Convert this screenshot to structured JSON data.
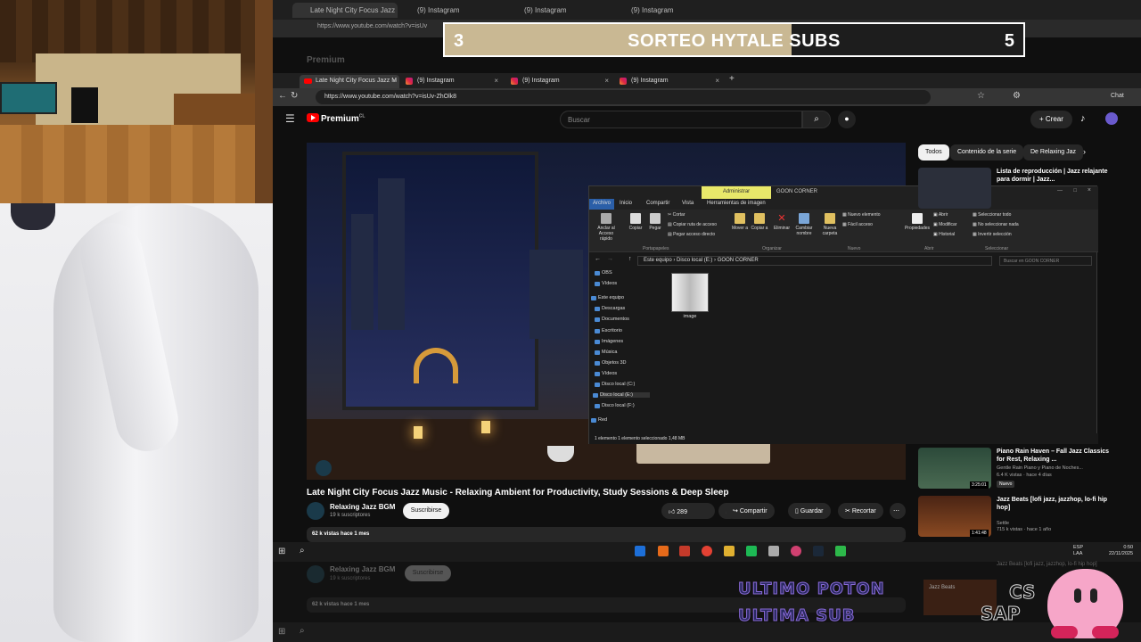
{
  "outer_tabs": [
    {
      "label": "Late Night City Focus Jazz M"
    },
    {
      "label": "(9) Instagram"
    },
    {
      "label": "(9) Instagram"
    },
    {
      "label": "(9) Instagram"
    }
  ],
  "outer_url": "https://www.youtube.com/watch?v=isUv",
  "sorteo": {
    "left_number": "3",
    "title": "SORTEO HYTALE SUBS",
    "right_number": "5",
    "progress_fraction": 0.6,
    "fill_color": "#c9b893"
  },
  "ghost_header": {
    "logo": "Premium"
  },
  "browser": {
    "tabs": [
      {
        "label": "Late Night City Focus Jazz M",
        "icon": "youtube-icon"
      },
      {
        "label": "(9) Instagram",
        "icon": "instagram-icon"
      },
      {
        "label": "(9) Instagram",
        "icon": "instagram-icon"
      },
      {
        "label": "(9) Instagram",
        "icon": "instagram-icon"
      }
    ],
    "new_tab": "+",
    "url": "https://www.youtube.com/watch?v=isUv-ZhOlk8",
    "chat_label": "Chat"
  },
  "youtube": {
    "logo": "Premium",
    "logo_sup": "CL",
    "search_placeholder": "Buscar",
    "create_label": "Crear",
    "chips": [
      "Todos",
      "Contenido de la serie",
      "De Relaxing Jaz"
    ],
    "video_title": "Late Night City Focus Jazz Music - Relaxing Ambient for Productivity, Study Sessions & Deep Sleep",
    "channel": "Relaxing Jazz BGM",
    "subscribers": "19 k suscriptores",
    "subscribe_label": "Suscribirse",
    "likes": "289",
    "share_label": "Compartir",
    "save_label": "Guardar",
    "clip_label": "Recortar",
    "views": "62 k vistas  hace 1 mes",
    "recommendations": [
      {
        "title": "Lista de reproducción | Jazz relajante para dormir | Jazz...",
        "meta1": "",
        "meta2": "",
        "duration": ""
      },
      {
        "title": "Piano Rain Haven – Fall Jazz Classics for Rest, Relaxing ...",
        "meta1": "Gentle Rain Piano y Piano de Noches...",
        "meta2": "6.4 K vistas · hace 4 días",
        "badge": "Nuevo",
        "duration": "3:25:01"
      },
      {
        "title": "Jazz Beats [lofi jazz, jazzhop, lo-fi hip hop]",
        "meta1": "Settle",
        "meta2": "715 k vistas · hace 1 año",
        "duration": "1:41:48"
      }
    ]
  },
  "explorer": {
    "admin_label": "Administrar",
    "window_title": "GOON CORNER",
    "menu": [
      "Archivo",
      "Inicio",
      "Compartir",
      "Vista",
      "Herramientas de imagen"
    ],
    "ribbon": {
      "pin": "Anclar al Acceso rápido",
      "copy": "Copiar",
      "paste": "Pegar",
      "cut": "Cortar",
      "copy_path": "Copiar ruta de acceso",
      "paste_shortcut": "Pegar acceso directo",
      "move": "Mover a",
      "copy_to": "Copiar a",
      "delete": "Eliminar",
      "rename": "Cambiar nombre",
      "new_folder": "Nueva carpeta",
      "new_item": "Nuevo elemento",
      "easy_access": "Fácil acceso",
      "properties": "Propiedades",
      "open": "Abrir",
      "modify": "Modificar",
      "history": "Historial",
      "select_all": "Seleccionar todo",
      "select_none": "No seleccionar nada",
      "invert": "Invertir selección",
      "groups": [
        "Portapapeles",
        "Organizar",
        "Nuevo",
        "Abrir",
        "Seleccionar"
      ]
    },
    "path": [
      "Este equipo",
      "Disco local (E:)",
      "GOON CORNER"
    ],
    "search_placeholder": "Buscar en GOON CORNER",
    "tree": [
      "OBS",
      "Vídeos",
      "Este equipo",
      "Descargas",
      "Documentos",
      "Escritorio",
      "Imágenes",
      "Música",
      "Objetos 3D",
      "Vídeos",
      "Disco local (C:)",
      "Disco local (E:)",
      "Disco local (F:)",
      "Red"
    ],
    "file_name": "image",
    "status": "1 elemento    1 elemento seleccionado  1,48 MB"
  },
  "taskbar": {
    "lang": "ESP\nLAA",
    "time": "0:50",
    "date": "22/11/2025"
  },
  "ghost_bottom": {
    "channel": "Relaxing Jazz BGM",
    "subs": "19 k suscriptores",
    "subscribe": "Suscribirse",
    "views": "62 k vistas  hace 1 mes",
    "rec_title": "Jazz Beats [lofi jazz, jazzhop, lo-fi hip hop]",
    "rec_thumb": "Jazz Beats"
  },
  "overlay": {
    "line1": "ULTIMO POTON",
    "line2": "ULTIMA SUB",
    "cs": "CS",
    "sap": "SAP"
  },
  "colors": {
    "youtube_red": "#ff0000",
    "accent_gold": "#c9b893",
    "explorer_admin": "#e8e86a"
  }
}
